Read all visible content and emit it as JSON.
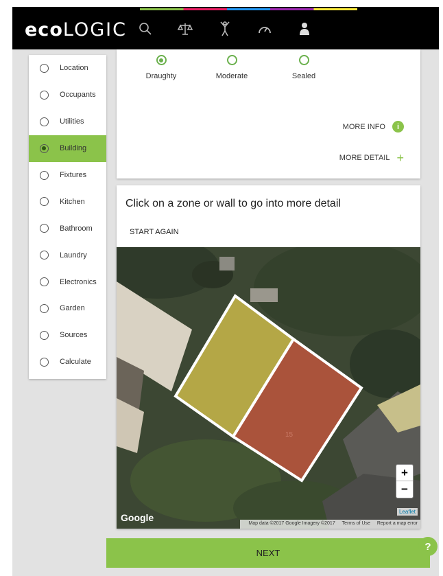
{
  "header": {
    "logo_bold": "eco",
    "logo_light": "LOGIC",
    "nav_icons": [
      "search-icon",
      "balance-scale-icon",
      "person-icon",
      "gauge-icon",
      "user-icon"
    ]
  },
  "sidebar": {
    "items": [
      {
        "label": "Location",
        "active": false
      },
      {
        "label": "Occupants",
        "active": false
      },
      {
        "label": "Utilities",
        "active": false
      },
      {
        "label": "Building",
        "active": true
      },
      {
        "label": "Fixtures",
        "active": false
      },
      {
        "label": "Kitchen",
        "active": false
      },
      {
        "label": "Bathroom",
        "active": false
      },
      {
        "label": "Laundry",
        "active": false
      },
      {
        "label": "Electronics",
        "active": false
      },
      {
        "label": "Garden",
        "active": false
      },
      {
        "label": "Sources",
        "active": false
      },
      {
        "label": "Calculate",
        "active": false
      }
    ],
    "active_color": "#8bc34a"
  },
  "airtightness": {
    "options": [
      {
        "label": "Draughty",
        "selected": true
      },
      {
        "label": "Moderate",
        "selected": false
      },
      {
        "label": "Sealed",
        "selected": false
      }
    ],
    "more_info_label": "MORE INFO",
    "more_detail_label": "MORE DETAIL"
  },
  "zones": {
    "title": "Click on a zone or wall to go into more detail",
    "start_again_label": "START AGAIN",
    "zone_label": "15",
    "map": {
      "provider_logo": "Google",
      "leaflet_label": "Leaflet",
      "attribution": [
        "Map data ©2017 Google Imagery ©2017",
        "Terms of Use",
        "Report a map error"
      ],
      "zoom_in": "+",
      "zoom_out": "−"
    }
  },
  "footer": {
    "next_label": "NEXT",
    "help_label": "?"
  },
  "colors": {
    "accent": "#8bc34a",
    "zone_yellow": "#c9b84a",
    "zone_red": "#b9553c"
  }
}
